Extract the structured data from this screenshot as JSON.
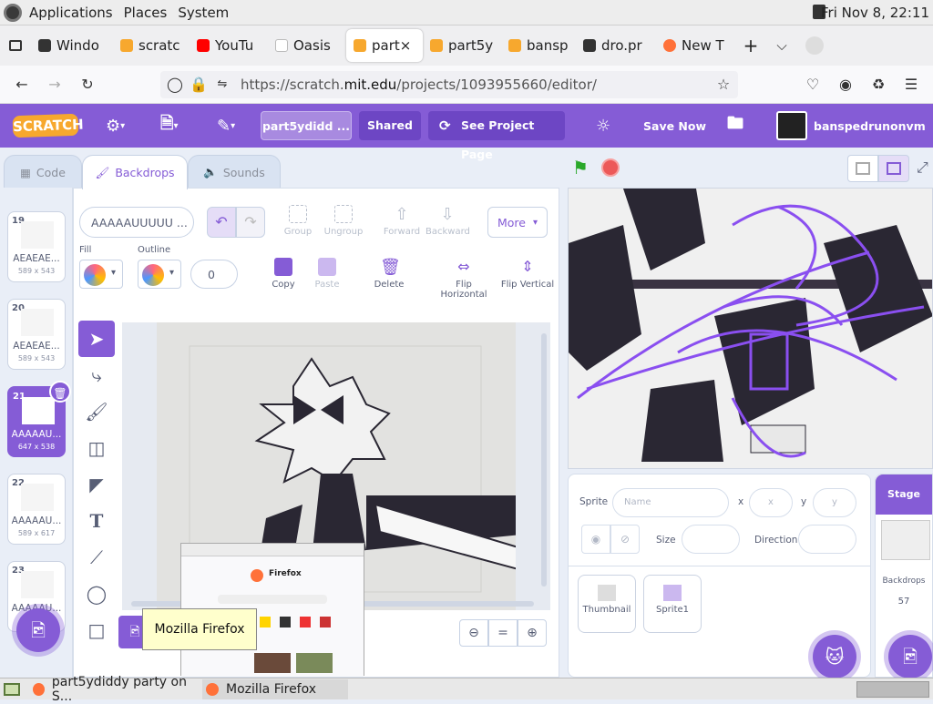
{
  "system_bar": {
    "menu": [
      "Applications",
      "Places",
      "System"
    ],
    "clock": "Fri Nov 8, 22:11"
  },
  "browser": {
    "tabs": [
      {
        "label": "Windo",
        "color": "#333333"
      },
      {
        "label": "scratc",
        "color": "#f7a82e"
      },
      {
        "label": "YouTu",
        "color": "#ff0000"
      },
      {
        "label": "Oasis",
        "color": "#dddddd"
      },
      {
        "label": "part×",
        "color": "#f7a82e",
        "active": true
      },
      {
        "label": "part5y",
        "color": "#f7a82e"
      },
      {
        "label": "bansp",
        "color": "#f7a82e"
      },
      {
        "label": "dro.pr",
        "color": "#333333"
      },
      {
        "label": "New T",
        "color": "#ff7139"
      }
    ],
    "new_tab": "+",
    "url_prefix": "https://scratch.",
    "url_domain": "mit.edu",
    "url_path": "/projects/1093955660/editor/"
  },
  "scratch": {
    "logo": "SCRATCH",
    "project_title": "part5ydidd ...",
    "shared": "Shared",
    "see_project": "See Project Page",
    "save_now": "Save Now",
    "username": "banspedrunonvm"
  },
  "editor_tabs": {
    "code": "Code",
    "backdrops": "Backdrops",
    "sounds": "Sounds"
  },
  "costumes": [
    {
      "num": "19",
      "name": "AEAEAE...",
      "size": "589 x 543"
    },
    {
      "num": "20",
      "name": "AEAEAE...",
      "size": "589 x 543"
    },
    {
      "num": "21",
      "name": "AAAAAU...",
      "size": "647 x 538",
      "selected": true
    },
    {
      "num": "22",
      "name": "AAAAAU...",
      "size": "589 x 617"
    },
    {
      "num": "23",
      "name": "AAAAAU...",
      "size": ""
    }
  ],
  "paint": {
    "costume_name": "AAAAAUUUUU ...",
    "fill_label": "Fill",
    "outline_label": "Outline",
    "outline_width": "0",
    "group": "Group",
    "ungroup": "Ungroup",
    "forward": "Forward",
    "backward": "Backward",
    "more": "More",
    "copy": "Copy",
    "paste": "Paste",
    "delete": "Delete",
    "flip_h": "Flip Horizontal",
    "flip_v": "Flip Vertical",
    "zoom_reset": "="
  },
  "sprite_info": {
    "sprite_label": "Sprite",
    "name_placeholder": "Name",
    "x_label": "x",
    "x_placeholder": "x",
    "y_label": "y",
    "y_placeholder": "y",
    "size_label": "Size",
    "direction_label": "Direction"
  },
  "sprites": [
    {
      "name": "Thumbnail"
    },
    {
      "name": "Sprite1"
    }
  ],
  "stage_pane": {
    "label": "Stage",
    "backdrops_label": "Backdrops",
    "backdrops_count": "57"
  },
  "tooltip": "Mozilla Firefox",
  "preview_title": "Firefox",
  "taskbar": [
    {
      "label": "part5ydiddy party on S..."
    },
    {
      "label": "Mozilla Firefox"
    }
  ],
  "colors": {
    "scratch_purple": "#855cd6",
    "accent_dark": "#6d46c4",
    "scratch_orange": "#f7a82e"
  }
}
